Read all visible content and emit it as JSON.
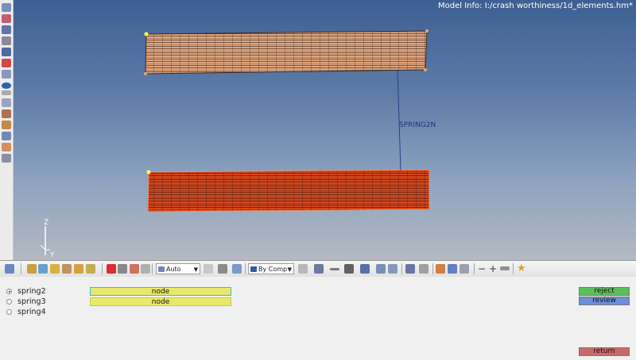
{
  "viewport": {
    "model_info": "Model Info: I:/crash worthiness/1d_elements.hm*",
    "spring_label": "SPRING2N",
    "axis_z": "Z",
    "axis_y": "Y",
    "colors": {
      "top_mesh": "#e0a57e",
      "bottom_mesh": "#d6461c",
      "spring": "#2a3f8a"
    }
  },
  "toolbar": {
    "auto_select": "Auto",
    "color_mode": "By Comp"
  },
  "panel": {
    "radios": [
      {
        "label": "spring2",
        "checked": true
      },
      {
        "label": "spring3",
        "checked": false
      },
      {
        "label": "spring4",
        "checked": false
      }
    ],
    "node_buttons": [
      "node",
      "node"
    ],
    "reject_label": "reject",
    "review_label": "review",
    "return_label": "return",
    "colors": {
      "node": "#e8e86a",
      "reject": "#5cbf5c",
      "review": "#6b8fd9",
      "return": "#c96a6a"
    }
  }
}
